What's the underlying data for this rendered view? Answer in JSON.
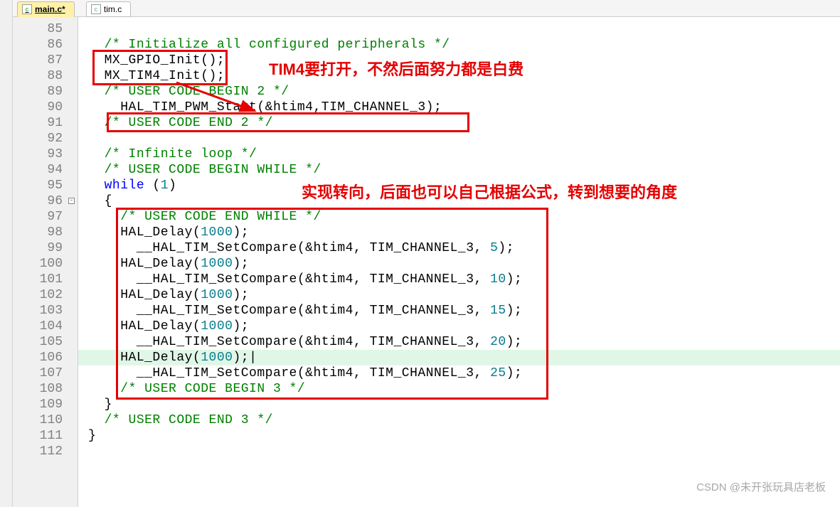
{
  "tabs": [
    {
      "label": "main.c*",
      "active": true
    },
    {
      "label": "tim.c",
      "active": false
    }
  ],
  "annotations": {
    "a1": "TIM4要打开，不然后面努力都是白费",
    "a2": "实现转向，后面也可以自己根据公式，转到想要的角度"
  },
  "watermark": "CSDN @未开张玩具店老板",
  "lines": {
    "start": 85,
    "end": 112
  },
  "code": {
    "c85": "",
    "c86_comment": "/* Initialize all configured peripherals */",
    "c87_a": "MX_GPIO_Init();",
    "c88_a": "MX_TIM4_Init();",
    "c89_comment": "/* USER CODE BEGIN 2 */",
    "c90_a": "HAL_TIM_PWM_Start(&htim4,TIM_CHANNEL_3);",
    "c91_comment": "/* USER CODE END 2 */",
    "c92": "",
    "c93_comment": "/* Infinite loop */",
    "c94_comment": "/* USER CODE BEGIN WHILE */",
    "c95_kw": "while",
    "c95_rest": " (",
    "c95_num": "1",
    "c95_end": ")",
    "c96": "{",
    "c97_comment": "/* USER CODE END WHILE */",
    "c98_a": "HAL_Delay(",
    "c98_num": "1000",
    "c98_b": ");",
    "c99_a": "  __HAL_TIM_SetCompare(&htim4, TIM_CHANNEL_3, ",
    "c99_num": "5",
    "c99_b": ");",
    "c100_a": "HAL_Delay(",
    "c100_num": "1000",
    "c100_b": ");",
    "c101_a": "  __HAL_TIM_SetCompare(&htim4, TIM_CHANNEL_3, ",
    "c101_num": "10",
    "c101_b": ");",
    "c102_a": "HAL_Delay(",
    "c102_num": "1000",
    "c102_b": ");",
    "c103_a": "  __HAL_TIM_SetCompare(&htim4, TIM_CHANNEL_3, ",
    "c103_num": "15",
    "c103_b": ");",
    "c104_a": "HAL_Delay(",
    "c104_num": "1000",
    "c104_b": ");",
    "c105_a": "  __HAL_TIM_SetCompare(&htim4, TIM_CHANNEL_3, ",
    "c105_num": "20",
    "c105_b": ");",
    "c106_a": "HAL_Delay(",
    "c106_num": "1000",
    "c106_b": ");|",
    "c107_a": "  __HAL_TIM_SetCompare(&htim4, TIM_CHANNEL_3, ",
    "c107_num": "25",
    "c107_b": ");",
    "c108_comment": "/* USER CODE BEGIN 3 */",
    "c109": "}",
    "c110_comment": "/* USER CODE END 3 */",
    "c111": "}",
    "c112": ""
  }
}
